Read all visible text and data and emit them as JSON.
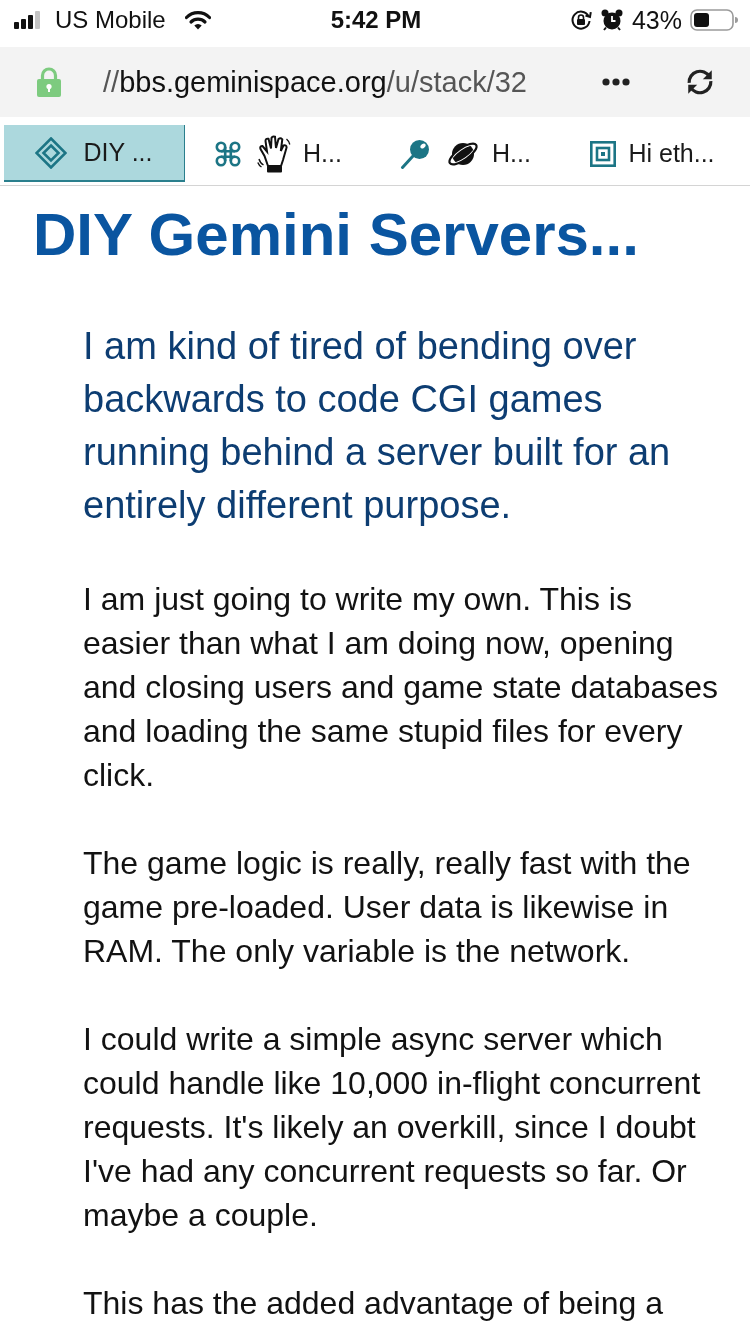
{
  "status_bar": {
    "carrier": "US Mobile",
    "time": "5:42 PM",
    "battery": "43%"
  },
  "address_bar": {
    "url": [
      {
        "text": "//",
        "kind": "dim"
      },
      {
        "text": "bbs.geminispace.org",
        "kind": "host"
      },
      {
        "text": "/u/stack/32",
        "kind": "dim"
      }
    ]
  },
  "tabs": [
    {
      "label": "DIY ...",
      "selected": true
    },
    {
      "label": "H...",
      "selected": false
    },
    {
      "label": "H...",
      "selected": false
    },
    {
      "label": "Hi eth...",
      "selected": false
    }
  ],
  "page": {
    "title": "DIY Gemini Servers...",
    "quote": {
      "lines": [
        "I am kind of tired of bending over",
        "backwards to code CGI games",
        "running behind a server built for an",
        "entirely different purpose."
      ]
    },
    "paragraphs": [
      {
        "lines": [
          "I am just going to write my own. This is",
          "easier than what I am doing now, opening",
          "and closing users and game state databases",
          "and loading the same stupid files for every",
          "click."
        ]
      },
      {
        "lines": [
          "The game logic is really, really fast with the",
          "game pre-loaded. User data is likewise in",
          "RAM. The only variable is the network."
        ]
      },
      {
        "lines": [
          "I could write a simple async server which",
          "could handle like 10,000 in-flight concurrent",
          "requests. It's likely an overkill, since I doubt",
          "I've had any concurrent requests so far. Or",
          "maybe a couple."
        ]
      },
      {
        "lines": [
          "This has the added advantage of being a"
        ]
      }
    ]
  }
}
